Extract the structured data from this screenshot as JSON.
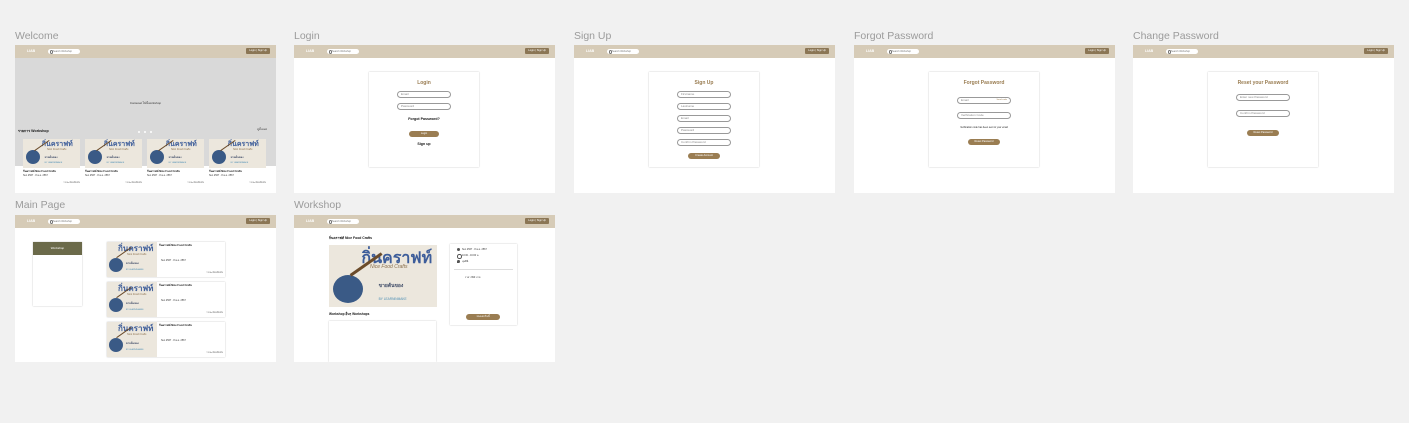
{
  "nav": {
    "logo": "LIAB",
    "search_placeholder": "Search Workshop",
    "auth_label": "Login | Sign Up"
  },
  "frames": {
    "welcome": {
      "title": "Welcome",
      "hero_text": "Carousel ไม่มีworkshop",
      "section_title": "รายการ Workshop",
      "see_all": "ดูทั้งหมด",
      "cards": [
        {
          "title": "กิ่นคราฟท์ Nice Food Crafts",
          "date": "Sun 2567 · 8 พ.ค. 2567",
          "meta": "รายละเอียดเพิ่มเติม"
        },
        {
          "title": "กิ่นคราฟท์ Nice Food Crafts",
          "date": "Sun 2567 · 8 พ.ค. 2567",
          "meta": "รายละเอียดเพิ่มเติม"
        },
        {
          "title": "กิ่นคราฟท์ Nice Food Crafts",
          "date": "Sun 2567 · 8 พ.ค. 2567",
          "meta": "รายละเอียดเพิ่มเติม"
        },
        {
          "title": "กิ่นคราฟท์ Nice Food Crafts",
          "date": "Sun 2567 · 8 พ.ค. 2567",
          "meta": "รายละเอียดเพิ่มเติม"
        }
      ]
    },
    "login": {
      "title": "Login",
      "form_title": "Login",
      "email_placeholder": "Email",
      "password_placeholder": "Password",
      "forgot_link": "Forgot Password?",
      "button": "Login",
      "signup_link": "Sign up"
    },
    "signup": {
      "title": "Sign Up",
      "form_title": "Sign Up",
      "fields": [
        "Firstname",
        "Lastname",
        "Email",
        "Password",
        "Confirm Password"
      ],
      "button": "Create Account"
    },
    "forgot": {
      "title": "Forgot Password",
      "form_title": "Forgot Password",
      "email_placeholder": "Email",
      "send_label": "Send code",
      "code_placeholder": "Verification Code",
      "note": "Verification code has been sent to your email",
      "button": "Reset Password"
    },
    "change": {
      "title": "Change Password",
      "form_title": "Reset your Password",
      "new_placeholder": "Enter new Password",
      "confirm_placeholder": "Confirm Password",
      "button": "Reset Password"
    },
    "main": {
      "title": "Main Page",
      "filter_label": "Workshop",
      "items": [
        {
          "title": "กิ่นคราฟท์ Nice Food Crafts",
          "date": "Sun 2567 · 8 พ.ค. 2567",
          "meta": "รายละเอียดเพิ่มเติม"
        },
        {
          "title": "กิ่นคราฟท์ Nice Food Crafts",
          "date": "Sun 2567 · 8 พ.ค. 2567",
          "meta": "รายละเอียดเพิ่มเติม"
        },
        {
          "title": "กิ่นคราฟท์ Nice Food Crafts",
          "date": "Sun 2567 · 8 พ.ค. 2567",
          "meta": "รายละเอียดเพิ่มเติม"
        }
      ]
    },
    "workshop": {
      "title": "Workshop",
      "heading": "กิ่นคราฟท์ Nice Food Crafts",
      "date": "Sun 2567 · 8 พ.ค. 2567",
      "time": "10:00 - 16:00 น.",
      "place": "ลุมพินี",
      "price": "ราคา 990 บาท",
      "book_button": "จองเลยวันนี้",
      "other_title": "Workshop อื่นๆ Workshops"
    }
  },
  "thumbnail": {
    "title": "กิ่นคราฟท์",
    "subtitle": "Nice Food Crafts",
    "thai_text": "ขายต้นของ",
    "blue_text": "BY LEARNINMAKE"
  },
  "colors": {
    "nav_bg": "#d6cbb7",
    "accent": "#9a7d52",
    "auth_btn": "#8b7655",
    "filter_panel": "#6b6a4a",
    "hero_bg": "#d9d9d9"
  }
}
